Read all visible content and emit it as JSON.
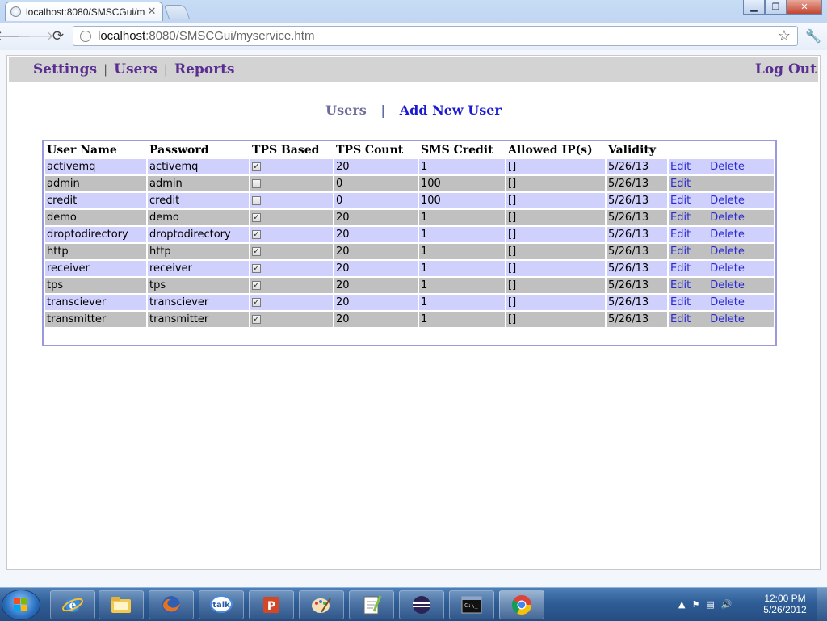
{
  "browser": {
    "tab_title": "localhost:8080/SMSCGui/m",
    "url_host": "localhost",
    "url_rest": ":8080/SMSCGui/myservice.htm",
    "window_controls": [
      "minimize",
      "maximize",
      "close"
    ]
  },
  "menu": {
    "items": [
      "Settings",
      "Users",
      "Reports"
    ],
    "separator": "|",
    "logout": "Log Out"
  },
  "subnav": {
    "current": "Users",
    "separator": "|",
    "add": "Add New User"
  },
  "table": {
    "headers": [
      "User Name",
      "Password",
      "TPS Based",
      "TPS Count",
      "SMS Credit",
      "Allowed IP(s)",
      "Validity"
    ],
    "edit_label": "Edit",
    "delete_label": "Delete",
    "rows": [
      {
        "user": "activemq",
        "password": "activemq",
        "tps_based": true,
        "tps_count": "20",
        "sms_credit": "1",
        "allowed_ips": "[]",
        "validity": "5/26/13",
        "can_delete": true
      },
      {
        "user": "admin",
        "password": "admin",
        "tps_based": false,
        "tps_count": "0",
        "sms_credit": "100",
        "allowed_ips": "[]",
        "validity": "5/26/13",
        "can_delete": false
      },
      {
        "user": "credit",
        "password": "credit",
        "tps_based": false,
        "tps_count": "0",
        "sms_credit": "100",
        "allowed_ips": "[]",
        "validity": "5/26/13",
        "can_delete": true
      },
      {
        "user": "demo",
        "password": "demo",
        "tps_based": true,
        "tps_count": "20",
        "sms_credit": "1",
        "allowed_ips": "[]",
        "validity": "5/26/13",
        "can_delete": true
      },
      {
        "user": "droptodirectory",
        "password": "droptodirectory",
        "tps_based": true,
        "tps_count": "20",
        "sms_credit": "1",
        "allowed_ips": "[]",
        "validity": "5/26/13",
        "can_delete": true
      },
      {
        "user": "http",
        "password": "http",
        "tps_based": true,
        "tps_count": "20",
        "sms_credit": "1",
        "allowed_ips": "[]",
        "validity": "5/26/13",
        "can_delete": true
      },
      {
        "user": "receiver",
        "password": "receiver",
        "tps_based": true,
        "tps_count": "20",
        "sms_credit": "1",
        "allowed_ips": "[]",
        "validity": "5/26/13",
        "can_delete": true
      },
      {
        "user": "tps",
        "password": "tps",
        "tps_based": true,
        "tps_count": "20",
        "sms_credit": "1",
        "allowed_ips": "[]",
        "validity": "5/26/13",
        "can_delete": true
      },
      {
        "user": "transciever",
        "password": "transciever",
        "tps_based": true,
        "tps_count": "20",
        "sms_credit": "1",
        "allowed_ips": "[]",
        "validity": "5/26/13",
        "can_delete": true
      },
      {
        "user": "transmitter",
        "password": "transmitter",
        "tps_based": true,
        "tps_count": "20",
        "sms_credit": "1",
        "allowed_ips": "[]",
        "validity": "5/26/13",
        "can_delete": true
      }
    ]
  },
  "taskbar": {
    "apps": [
      "internet-explorer-icon",
      "file-explorer-icon",
      "firefox-icon",
      "google-talk-icon",
      "powerpoint-icon",
      "paint-icon",
      "notepad-plus-plus-icon",
      "eclipse-icon",
      "command-prompt-icon",
      "chrome-icon"
    ],
    "clock_time": "12:00 PM",
    "clock_date": "5/26/2012"
  },
  "colors": {
    "menu_link": "#5a2d91",
    "row_odd": "#d0d0fc",
    "row_even": "#c0c0c0",
    "table_border": "#9999dd",
    "action_link": "#2a2ad0"
  }
}
